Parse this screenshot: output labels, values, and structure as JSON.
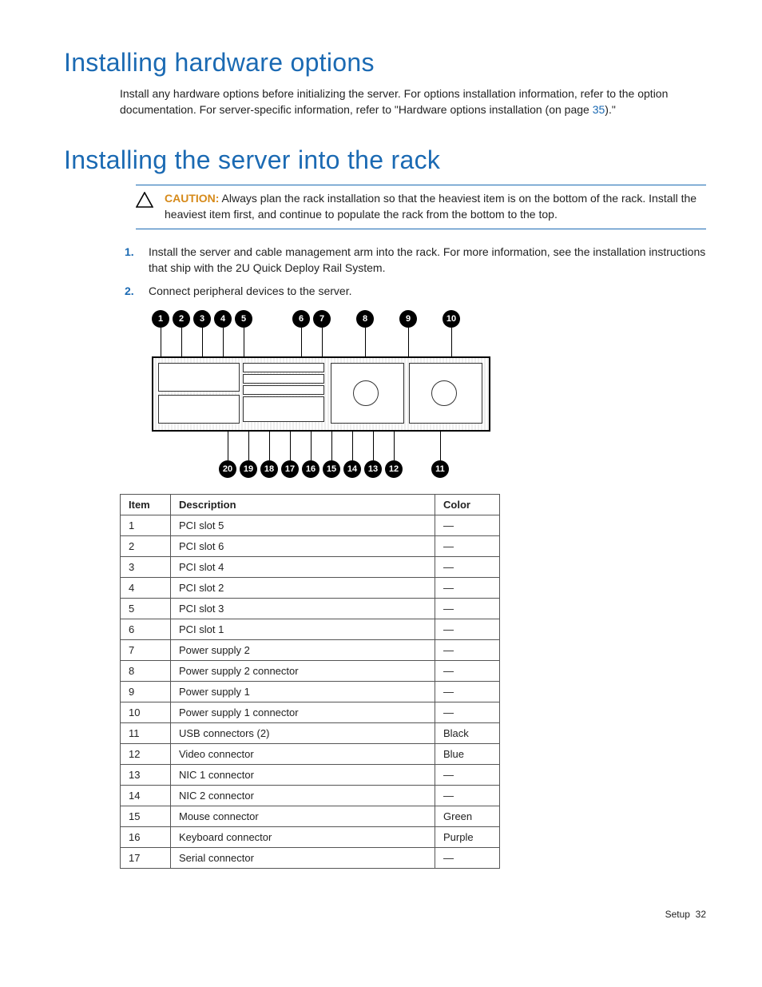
{
  "section1": {
    "heading": "Installing hardware options",
    "intro_pre": "Install any hardware options before initializing the server. For options installation information, refer to the option documentation. For server-specific information, refer to \"Hardware options installation (on page ",
    "intro_link": "35",
    "intro_post": ").\""
  },
  "section2": {
    "heading": "Installing the server into the rack",
    "caution_label": "CAUTION:",
    "caution_text": "  Always plan the rack installation so that the heaviest item is on the bottom of the rack. Install the heaviest item first, and continue to populate the rack from the bottom to the top.",
    "steps": [
      "Install the server and cable management arm into the rack. For more information, see the installation instructions that ship with the 2U Quick Deploy Rail System.",
      "Connect peripheral devices to the server."
    ]
  },
  "diagram": {
    "top_bubbles": [
      "1",
      "2",
      "3",
      "4",
      "5",
      "6",
      "7",
      "8",
      "9",
      "10"
    ],
    "bottom_bubbles": [
      "20",
      "19",
      "18",
      "17",
      "16",
      "15",
      "14",
      "13",
      "12",
      "11"
    ]
  },
  "table": {
    "headers": {
      "item": "Item",
      "desc": "Description",
      "color": "Color"
    },
    "rows": [
      {
        "item": "1",
        "desc": "PCI slot 5",
        "color": "—"
      },
      {
        "item": "2",
        "desc": "PCI slot 6",
        "color": "—"
      },
      {
        "item": "3",
        "desc": "PCI slot 4",
        "color": "—"
      },
      {
        "item": "4",
        "desc": "PCI slot 2",
        "color": "—"
      },
      {
        "item": "5",
        "desc": "PCI slot 3",
        "color": "—"
      },
      {
        "item": "6",
        "desc": "PCI slot 1",
        "color": "—"
      },
      {
        "item": "7",
        "desc": "Power supply 2",
        "color": "—"
      },
      {
        "item": "8",
        "desc": "Power supply 2 connector",
        "color": "—"
      },
      {
        "item": "9",
        "desc": "Power supply 1",
        "color": "—"
      },
      {
        "item": "10",
        "desc": "Power supply 1 connector",
        "color": "—"
      },
      {
        "item": "11",
        "desc": "USB connectors (2)",
        "color": "Black"
      },
      {
        "item": "12",
        "desc": "Video connector",
        "color": "Blue"
      },
      {
        "item": "13",
        "desc": "NIC 1 connector",
        "color": "—"
      },
      {
        "item": "14",
        "desc": "NIC 2 connector",
        "color": "—"
      },
      {
        "item": "15",
        "desc": "Mouse connector",
        "color": "Green"
      },
      {
        "item": "16",
        "desc": "Keyboard connector",
        "color": "Purple"
      },
      {
        "item": "17",
        "desc": "Serial connector",
        "color": "—"
      }
    ]
  },
  "footer": {
    "section": "Setup",
    "page": "32"
  }
}
